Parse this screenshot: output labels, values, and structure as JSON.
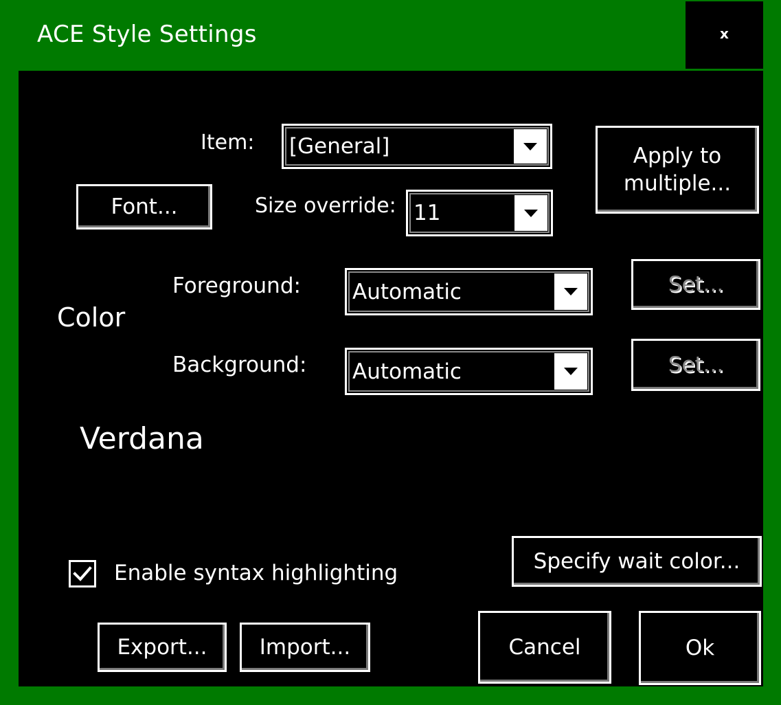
{
  "window": {
    "title": "ACE Style Settings",
    "close_label": "x"
  },
  "item": {
    "label": "Item:",
    "value": "[General]"
  },
  "font_button": "Font...",
  "size": {
    "label": "Size override:",
    "value": "11"
  },
  "apply_button": "Apply to multiple...",
  "color": {
    "label": "Color",
    "foreground_label": "Foreground:",
    "foreground_value": "Automatic",
    "background_label": "Background:",
    "background_value": "Automatic",
    "set_label": "Set..."
  },
  "preview_text": "Verdana",
  "syntax": {
    "label": "Enable syntax highlighting",
    "checked": true
  },
  "wait_color_button": "Specify wait color...",
  "buttons": {
    "export": "Export...",
    "import": "Import...",
    "cancel": "Cancel",
    "ok": "Ok"
  },
  "colors": {
    "title_bar": "#007a00",
    "background": "#000000",
    "foreground": "#ffffff",
    "disabled_text": "#8a8a8a"
  },
  "icons": {
    "close": "close-icon",
    "dropdown": "chevron-down-icon",
    "check": "check-icon"
  }
}
